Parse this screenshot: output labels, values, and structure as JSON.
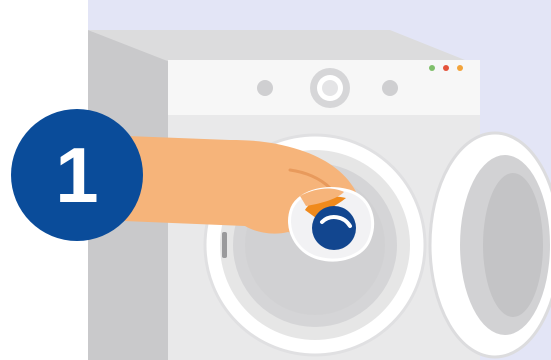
{
  "step": {
    "number": "1",
    "badge_color": "#0a4c9a"
  },
  "colors": {
    "wall": "#e3e5f6",
    "machine_body": "#e9e9ea",
    "machine_side": "#c9c9cb",
    "control_panel": "#f7f7f7",
    "door_ring": "#e6e6e6",
    "drum": "#d5d5d7",
    "skin": "#f6b47a",
    "pod_orange": "#f08a1c",
    "pod_blue": "#12468f",
    "indicator_lights": [
      "#7fbf6b",
      "#e4523b",
      "#f2a33a"
    ]
  },
  "icons": {
    "washing_machine": "washing-machine-icon",
    "hand": "hand-icon",
    "detergent_pod": "detergent-pod-icon"
  }
}
